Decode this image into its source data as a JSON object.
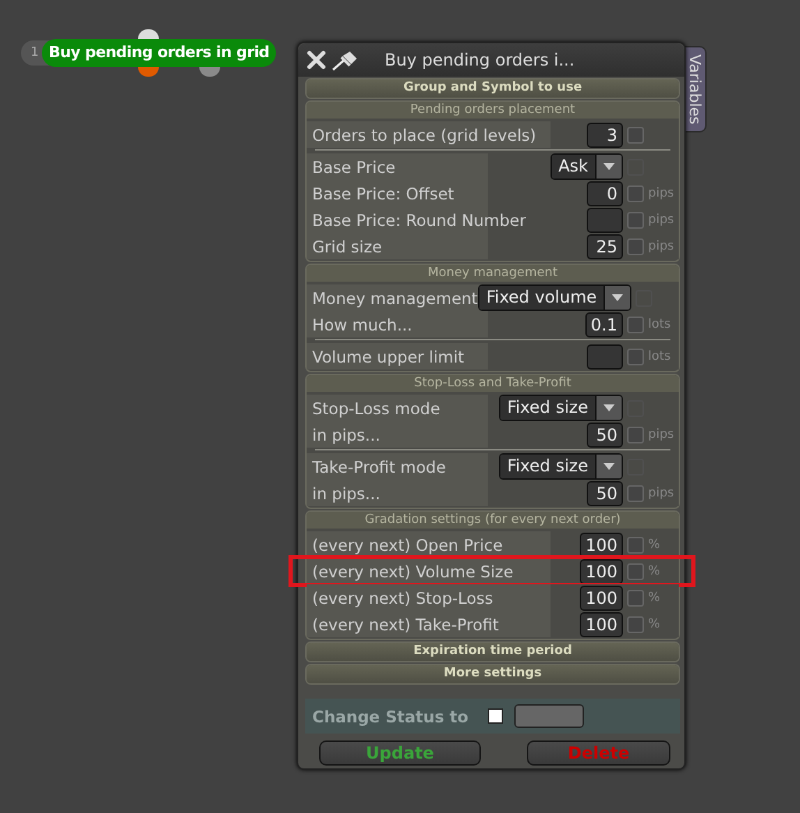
{
  "node": {
    "number": "1",
    "label": "Buy pending orders in grid"
  },
  "dialog": {
    "title": "Buy pending orders i...",
    "side_tab": "Variables",
    "sections": [
      {
        "title": "Group and Symbol to use",
        "expanded": false
      },
      {
        "title": "Pending orders placement",
        "expanded": true,
        "groups": [
          [
            {
              "label": "Orders to place (grid levels)",
              "kind": "number",
              "value": "3",
              "checked": false,
              "highlighted": false
            }
          ],
          [
            {
              "label": "Base Price",
              "kind": "select",
              "value": "Ask",
              "checked": false,
              "highlighted": false
            },
            {
              "label": "Base Price: Offset",
              "kind": "number",
              "value": "0",
              "unit": "pips",
              "checked": false,
              "highlighted": false
            },
            {
              "label": "Base Price: Round Number",
              "kind": "number",
              "unit": "pips",
              "checked": false,
              "highlighted": false
            },
            {
              "label": "Grid size",
              "kind": "number",
              "value": "25",
              "unit": "pips",
              "checked": false,
              "highlighted": false
            }
          ]
        ]
      },
      {
        "title": "Money management",
        "expanded": true,
        "groups": [
          [
            {
              "label": "Money management",
              "kind": "select",
              "value": "Fixed volume",
              "checked": false,
              "highlighted": false
            },
            {
              "label": "How much...",
              "kind": "number",
              "value": "0.1",
              "unit": "lots",
              "checked": false,
              "highlighted": false
            }
          ],
          [
            {
              "label": "Volume upper limit",
              "kind": "number",
              "unit": "lots",
              "checked": false,
              "highlighted": false
            }
          ]
        ]
      },
      {
        "title": "Stop-Loss and Take-Profit",
        "expanded": true,
        "groups": [
          [
            {
              "label": "Stop-Loss mode",
              "kind": "select",
              "value": "Fixed size",
              "checked": false,
              "highlighted": false
            },
            {
              "label": "in pips...",
              "kind": "number",
              "value": "50",
              "unit": "pips",
              "checked": false,
              "highlighted": false
            }
          ],
          [
            {
              "label": "Take-Profit mode",
              "kind": "select",
              "value": "Fixed size",
              "checked": false,
              "highlighted": false
            },
            {
              "label": "in pips...",
              "kind": "number",
              "value": "50",
              "unit": "pips",
              "checked": false,
              "highlighted": false
            }
          ]
        ]
      },
      {
        "title": "Gradation settings (for every next order)",
        "expanded": true,
        "groups": [
          [
            {
              "label": "(every next) Open Price",
              "kind": "number",
              "value": "100",
              "unit": "%",
              "checked": false,
              "highlighted": false
            },
            {
              "label": "(every next) Volume Size",
              "kind": "number",
              "value": "100",
              "unit": "%",
              "checked": false,
              "highlighted": true
            },
            {
              "label": "(every next) Stop-Loss",
              "kind": "number",
              "value": "100",
              "unit": "%",
              "checked": false,
              "highlighted": false
            },
            {
              "label": "(every next) Take-Profit",
              "kind": "number",
              "value": "100",
              "unit": "%",
              "checked": false,
              "highlighted": false
            }
          ]
        ]
      },
      {
        "title": "Expiration time period",
        "expanded": false
      },
      {
        "title": "More settings",
        "expanded": false
      }
    ],
    "status": {
      "label": "Change Status to",
      "checked": false
    },
    "buttons": [
      {
        "label": "Update",
        "kind": "update"
      },
      {
        "label": "Delete",
        "kind": "delete"
      }
    ]
  }
}
